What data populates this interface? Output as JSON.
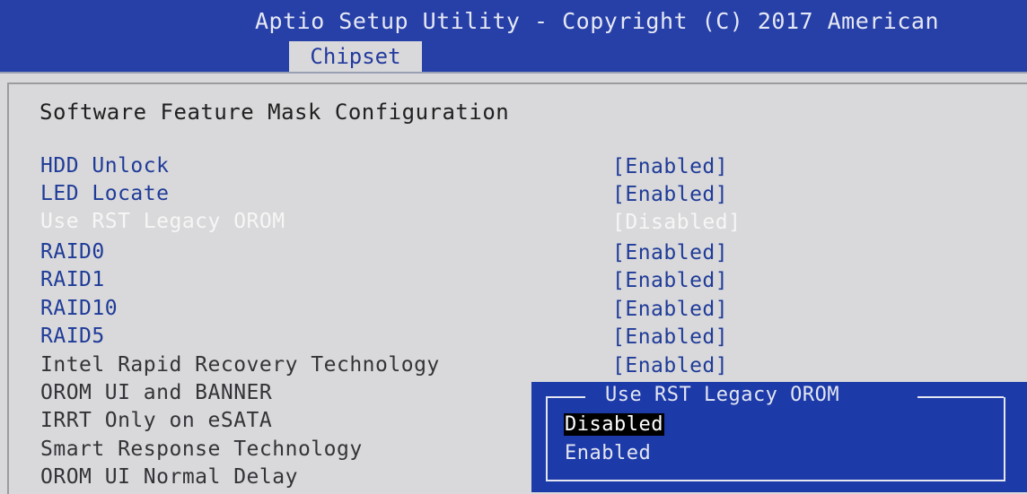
{
  "header": {
    "title": "Aptio Setup Utility - Copyright (C) 2017 American",
    "active_tab": "Chipset"
  },
  "section_title": "Software Feature Mask Configuration",
  "settings": [
    {
      "label": "HDD Unlock",
      "value": "[Enabled]"
    },
    {
      "label": "LED Locate",
      "value": "[Enabled]"
    },
    {
      "label": "Use RST Legacy OROM",
      "value": "[Disabled]"
    },
    {
      "label": "RAID0",
      "value": "[Enabled]"
    },
    {
      "label": "RAID1",
      "value": "[Enabled]"
    },
    {
      "label": "RAID10",
      "value": "[Enabled]"
    },
    {
      "label": "RAID5",
      "value": "[Enabled]"
    },
    {
      "label": "Intel Rapid Recovery Technology",
      "value": "[Enabled]"
    },
    {
      "label": "OROM UI and BANNER",
      "value": ""
    },
    {
      "label": "IRRT Only on eSATA",
      "value": ""
    },
    {
      "label": "Smart Response Technology",
      "value": ""
    },
    {
      "label": "OROM UI Normal Delay",
      "value": ""
    }
  ],
  "popup": {
    "title": "Use RST Legacy OROM",
    "options": [
      "Disabled",
      "Enabled"
    ],
    "selected": "Disabled"
  },
  "colors": {
    "header_bg": "#2640a8",
    "page_bg": "#d9d9db",
    "setting_text": "#1f3b98",
    "highlight_text": "#f6f6f6",
    "popup_bg": "#1c3aa8"
  }
}
